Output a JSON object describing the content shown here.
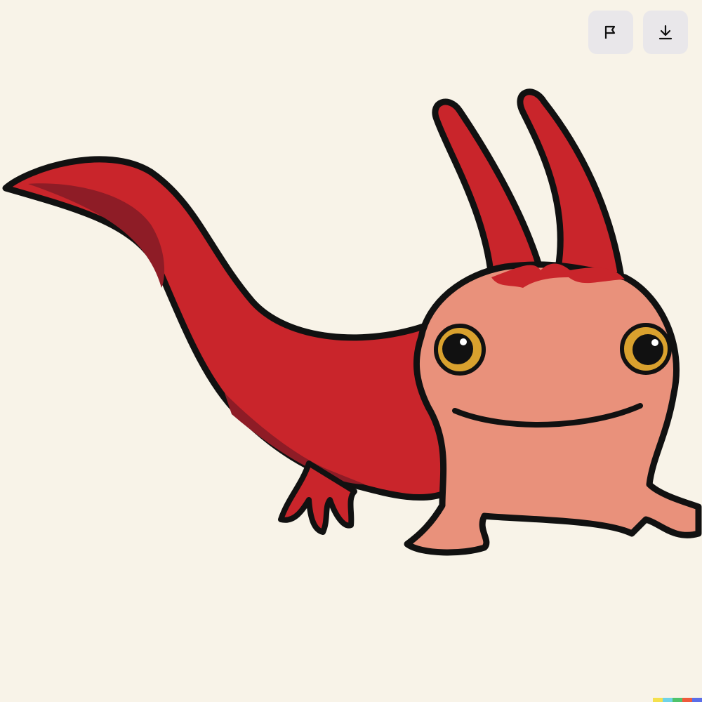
{
  "image": {
    "subject_icon": "cartoon-red-axolotl-illustration",
    "background_color": "#f8f3e8"
  },
  "toolbar": {
    "report_icon": "flag-icon",
    "download_icon": "download-icon",
    "button_background": "#e9e7ea"
  },
  "colors": {
    "body_red": "#c9252b",
    "body_shadow": "#8e1c26",
    "face_pink": "#e9917b",
    "eye_gold": "#d9a12e",
    "outline": "#111111"
  },
  "signature_colors": [
    "#f4e04d",
    "#6fd3e8",
    "#4fc36a",
    "#ef5a3c",
    "#5b6ee8"
  ]
}
